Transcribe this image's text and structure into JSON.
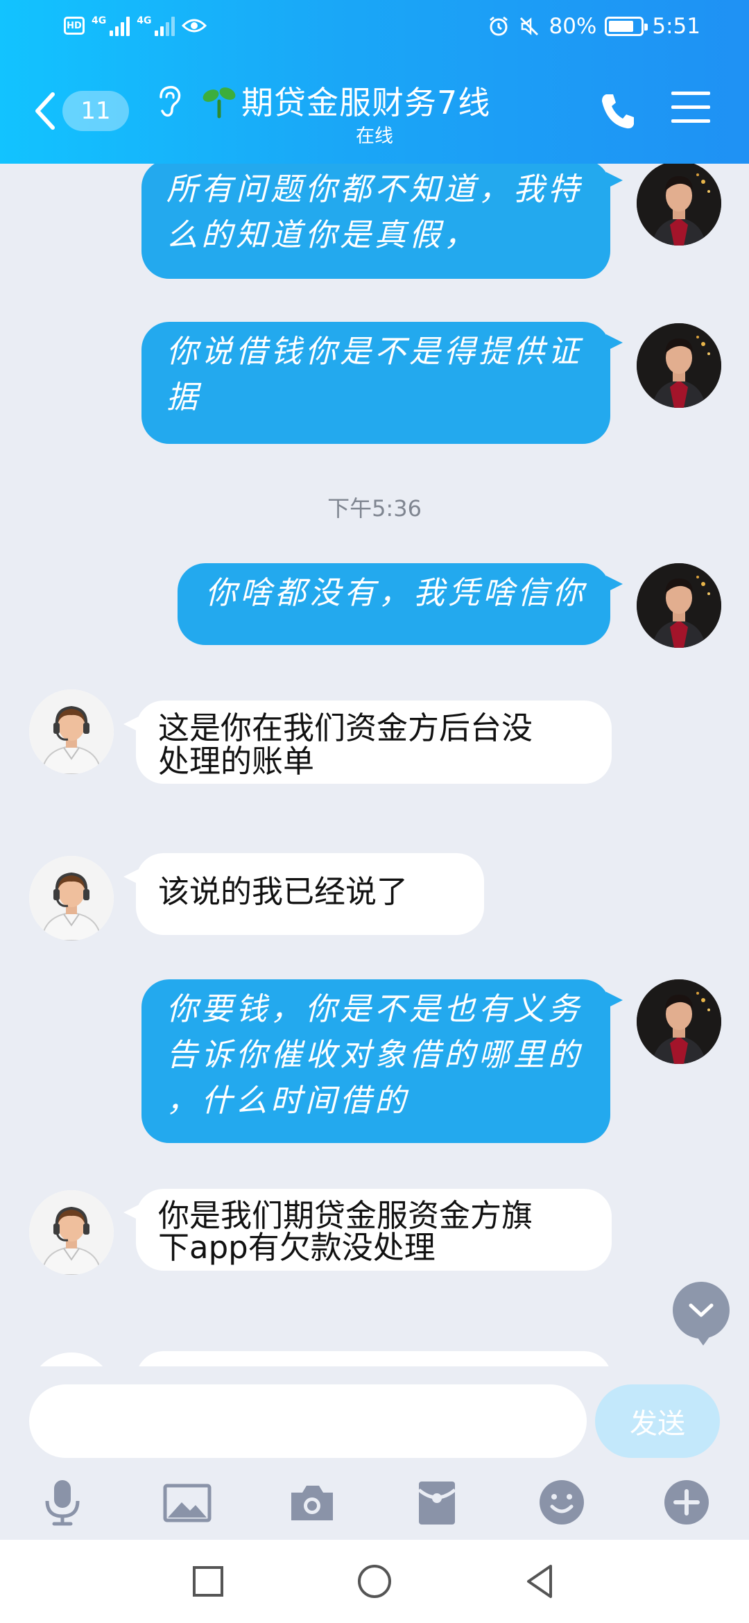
{
  "status_bar": {
    "hd": "HD",
    "signal1_label": "4G",
    "signal2_label": "4G",
    "battery_percent": "80%",
    "battery_level": 0.8,
    "time": "5:51"
  },
  "header": {
    "unread_count": "11",
    "title": "期贷金服财务7线",
    "subtitle": "在线"
  },
  "messages": [
    {
      "sender": "me",
      "lines": [
        "所有问题你都不知道，我特",
        "么的知道你是真假，"
      ]
    },
    {
      "sender": "me",
      "lines": [
        "你说借钱你是不是得提供证",
        "据"
      ]
    },
    {
      "type": "time",
      "text": "下午5:36"
    },
    {
      "sender": "me",
      "lines": [
        "你啥都没有，我凭啥信你"
      ]
    },
    {
      "sender": "agent",
      "lines": [
        "这是你在我们资金方后台没",
        "处理的账单"
      ]
    },
    {
      "sender": "agent",
      "lines": [
        "该说的我已经说了"
      ]
    },
    {
      "sender": "me",
      "lines": [
        "你要钱，你是不是也有义务",
        "告诉你催收对象借的哪里的",
        "，什么时间借的"
      ]
    },
    {
      "sender": "agent",
      "lines": [
        "你是我们期贷金服资金方旗",
        "下app有欠款没处理"
      ]
    }
  ],
  "input": {
    "placeholder": "",
    "send_label": "发送"
  },
  "toolbar": {
    "icons": [
      "microphone-icon",
      "image-icon",
      "camera-icon",
      "red-packet-icon",
      "emoji-icon",
      "plus-icon"
    ]
  },
  "colors": {
    "header_start": "#12c3ff",
    "header_end": "#1f91f4",
    "my_bubble": "#23a9ee",
    "send_button": "#c3e8fb",
    "chat_bg": "#eaedf4"
  }
}
